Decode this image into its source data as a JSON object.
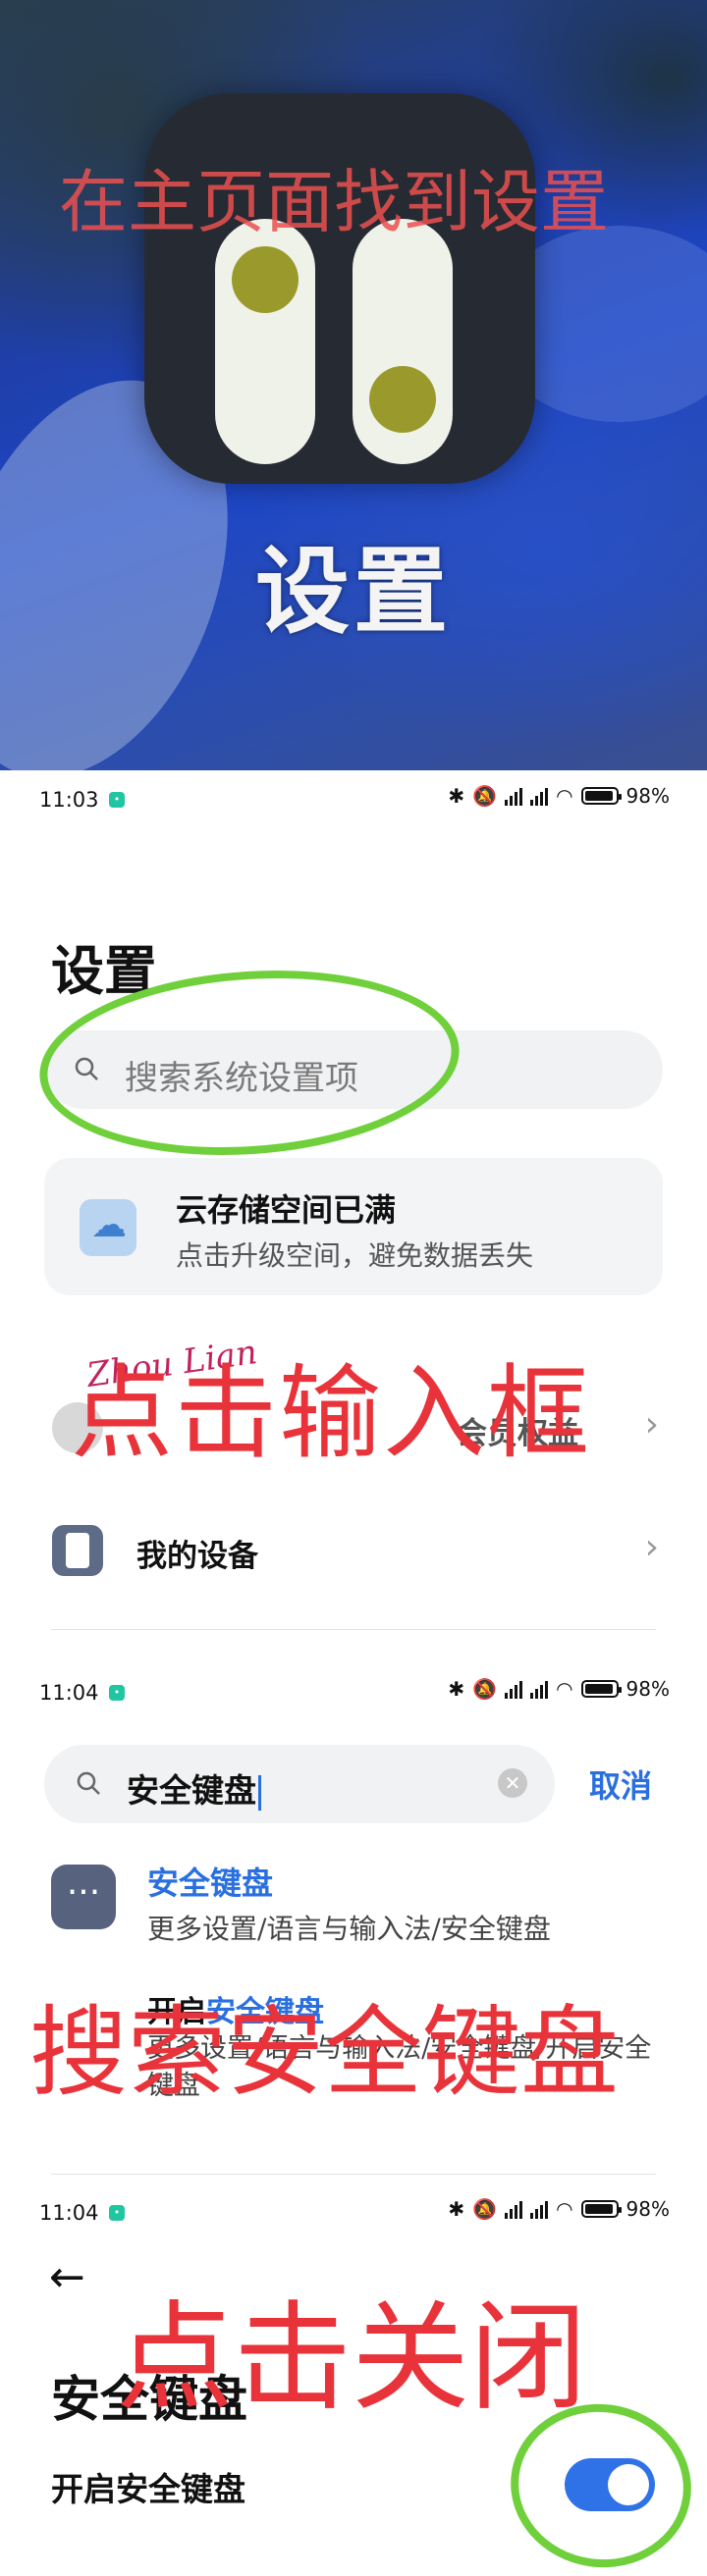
{
  "panel1": {
    "overlay_text": "在主页面找到设置",
    "app_label": "设置"
  },
  "status_bar_1": {
    "time": "11:03",
    "battery": "98"
  },
  "status_bar_2": {
    "time": "11:04",
    "battery": "98"
  },
  "status_bar_3": {
    "time": "11:04",
    "battery": "98"
  },
  "settings_screen": {
    "title": "设置",
    "search_placeholder": "搜索系统设置项",
    "cloud_card": {
      "title": "云存储空间已满",
      "subtitle": "点击升级空间，避免数据丢失"
    },
    "account_row": {
      "label": "会员权益"
    },
    "device_row": {
      "label": "我的设备"
    },
    "scribble": "Zhou Lian",
    "overlay_text": "点击输入框"
  },
  "search_screen": {
    "query": "安全键盘",
    "cancel_label": "取消",
    "result_title": "安全键盘",
    "result_path": "更多设置/语言与输入法/安全键盘",
    "sub_result_prefix": "开启",
    "sub_result_highlight": "安全键盘",
    "sub_result_path": "更多设置/语言与输入法/安全键盘/开启安全键盘",
    "overlay_text": "搜索安全键盘"
  },
  "keyboard_screen": {
    "title": "安全键盘",
    "toggle_label": "开启安全键盘",
    "toggle_on": true,
    "overlay_text": "点击关闭"
  },
  "colors": {
    "accent_blue": "#2a6fe0",
    "annotation_red": "#e8333a",
    "annotation_green": "#6fd03b"
  }
}
